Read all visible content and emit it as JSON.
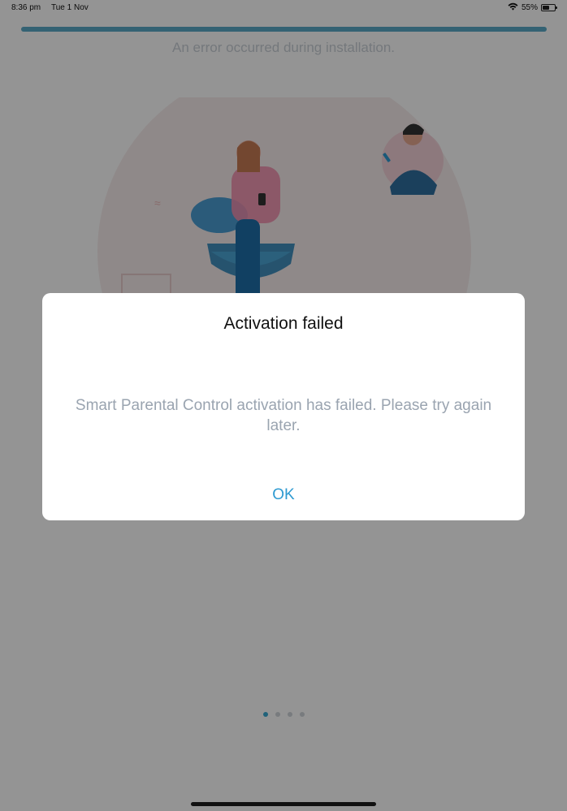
{
  "status_bar": {
    "time": "8:36 pm",
    "date": "Tue 1 Nov",
    "battery": "55%",
    "wifi_icon": "wifi-icon",
    "battery_icon": "battery-icon",
    "battery_level": 0.55
  },
  "install_screen": {
    "progress": 1.0,
    "error_text": "An error occurred during installation.",
    "page_dots": {
      "count": 4,
      "active_index": 0
    }
  },
  "dialog": {
    "title": "Activation failed",
    "message": "Smart Parental Control activation has failed. Please try again later.",
    "ok_label": "OK"
  },
  "colors": {
    "accent": "#2e9ad1",
    "progress_fill": "#5aa9c7",
    "message_text": "#9aa4b0"
  }
}
